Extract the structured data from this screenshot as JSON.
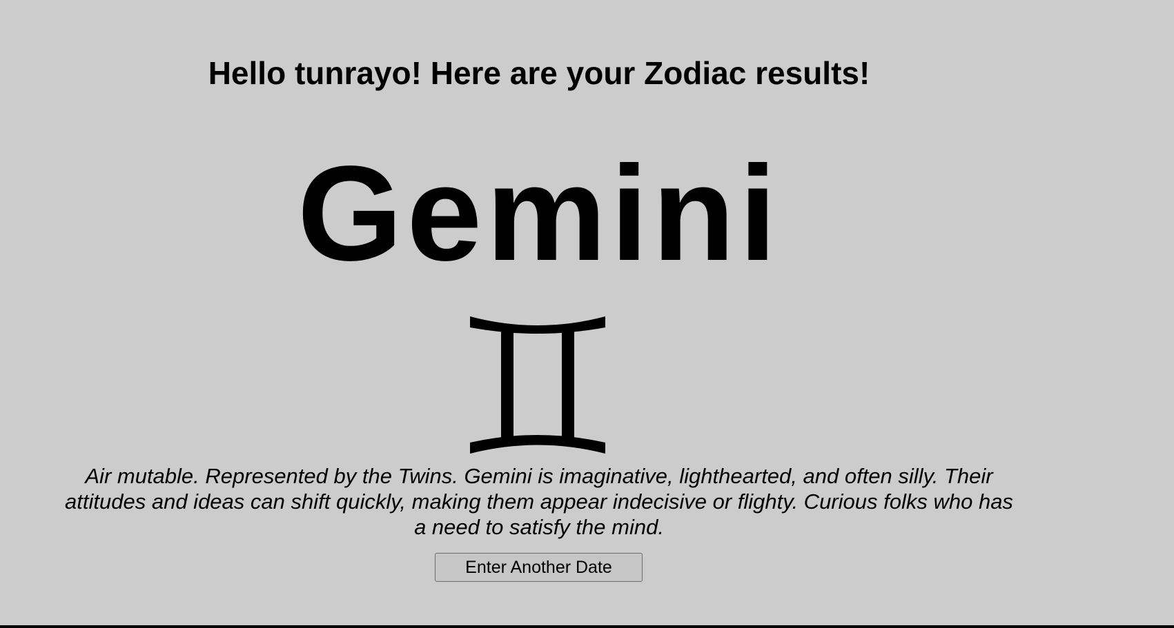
{
  "page": {
    "background_color": "#cccccc",
    "text_color": "#000000"
  },
  "greeting": "Hello tunrayo! Here are your Zodiac results!",
  "sign": {
    "name": "Gemini",
    "symbol_icon": "gemini-glyph-icon",
    "description": "Air mutable. Represented by the Twins. Gemini is imaginative, lighthearted, and often silly. Their attitudes and ideas can shift quickly, making them appear indecisive or flighty. Curious folks who has a need to satisfy the mind."
  },
  "actions": {
    "another_date_label": "Enter Another Date"
  }
}
